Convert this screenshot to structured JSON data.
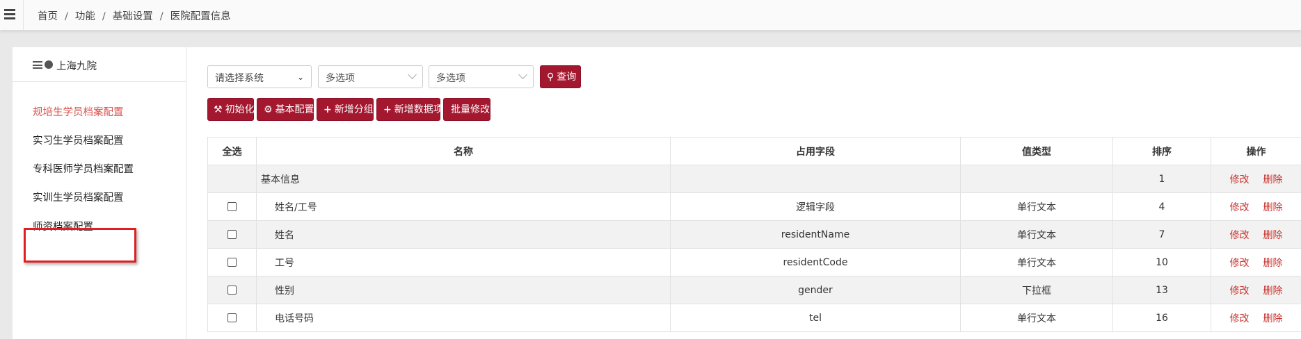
{
  "breadcrumb": [
    "首页",
    "功能",
    "基础设置",
    "医院配置信息"
  ],
  "sidebar": {
    "hospital": "上海九院",
    "items": [
      {
        "label": "规培生学员档案配置",
        "active": true
      },
      {
        "label": "实习生学员档案配置",
        "active": false
      },
      {
        "label": "专科医师学员档案配置",
        "active": false
      },
      {
        "label": "实训生学员档案配置",
        "active": false
      },
      {
        "label": "师资档案配置",
        "active": false
      }
    ]
  },
  "filters": {
    "system_select": "请选择系统",
    "multi1": "多选项",
    "multi2": "多选项",
    "query_button": "查询"
  },
  "toolbar": {
    "init": "初始化",
    "basic_config": "基本配置",
    "add_group": "新增分组",
    "add_data_item": "新增数据项",
    "batch_edit": "批量修改"
  },
  "table": {
    "headers": [
      "全选",
      "名称",
      "占用字段",
      "值类型",
      "排序",
      "操作"
    ],
    "rows": [
      {
        "group": true,
        "name": "基本信息",
        "field": "",
        "type": "",
        "sort": "1"
      },
      {
        "group": false,
        "name": "姓名/工号",
        "field": "逻辑字段",
        "type": "单行文本",
        "sort": "4"
      },
      {
        "group": false,
        "name": "姓名",
        "field": "residentName",
        "type": "单行文本",
        "sort": "7"
      },
      {
        "group": false,
        "name": "工号",
        "field": "residentCode",
        "type": "单行文本",
        "sort": "10"
      },
      {
        "group": false,
        "name": "性别",
        "field": "gender",
        "type": "下拉框",
        "sort": "13"
      },
      {
        "group": false,
        "name": "电话号码",
        "field": "tel",
        "type": "单行文本",
        "sort": "16"
      }
    ],
    "ops": {
      "edit": "修改",
      "delete": "删除"
    }
  },
  "colors": {
    "accent": "#a3172f",
    "active_menu": "#d9534f",
    "link": "#c9302c",
    "highlight": "#e02020"
  }
}
